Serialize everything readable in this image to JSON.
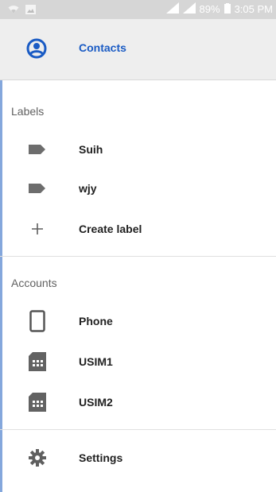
{
  "status_bar": {
    "battery": "89%",
    "time": "3:05 PM",
    "icons": [
      "wifi-icon",
      "image-notification-icon",
      "signal-icon",
      "battery-icon"
    ]
  },
  "header": {
    "label": "Contacts",
    "icon": "account-circle-icon",
    "accent_color": "#1a5bc4"
  },
  "labels_section": {
    "title": "Labels",
    "items": [
      {
        "label": "Suih",
        "icon": "label-tag-icon"
      },
      {
        "label": "wjy",
        "icon": "label-tag-icon"
      },
      {
        "label": "Create label",
        "icon": "plus-icon"
      }
    ]
  },
  "accounts_section": {
    "title": "Accounts",
    "items": [
      {
        "label": "Phone",
        "icon": "phone-device-icon"
      },
      {
        "label": "USIM1",
        "icon": "sim-card-icon"
      },
      {
        "label": "USIM2",
        "icon": "sim-card-icon"
      }
    ]
  },
  "settings": {
    "label": "Settings",
    "icon": "gear-icon"
  }
}
